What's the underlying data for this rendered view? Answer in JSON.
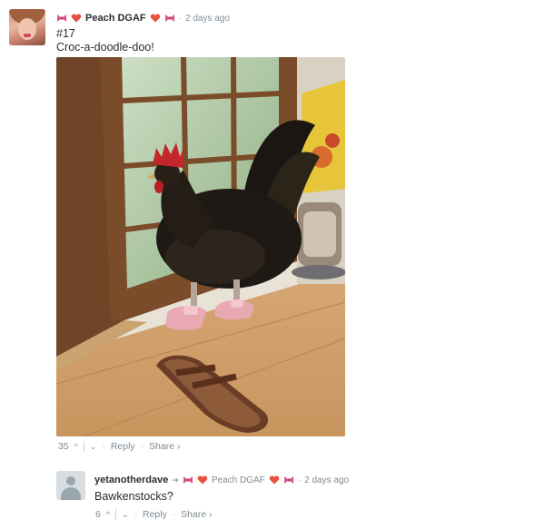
{
  "comment1": {
    "username": "Peach DGAF",
    "timestamp": "2 days ago",
    "body_line1": "#17",
    "body_line2": "Croc-a-doodle-doo!",
    "votes": "35",
    "reply_label": "Reply",
    "share_label": "Share ›"
  },
  "reply": {
    "username": "yetanotherdave",
    "in_reply_to": "Peach DGAF",
    "timestamp": "2 days ago",
    "body": "Bawkenstocks?",
    "votes": "6",
    "reply_label": "Reply",
    "share_label": "Share ›"
  },
  "icons": {
    "upvote": "upvote-chevron-icon",
    "downvote": "downvote-chevron-icon",
    "reply_arrow": "reply-arrow-icon",
    "bow": "pink-bow-emoji",
    "heart": "heart-emoji"
  },
  "colors": {
    "text": "#2a2e2e",
    "meta": "#7f8b92",
    "bow": "#e0508a",
    "heart": "#e8503f"
  }
}
